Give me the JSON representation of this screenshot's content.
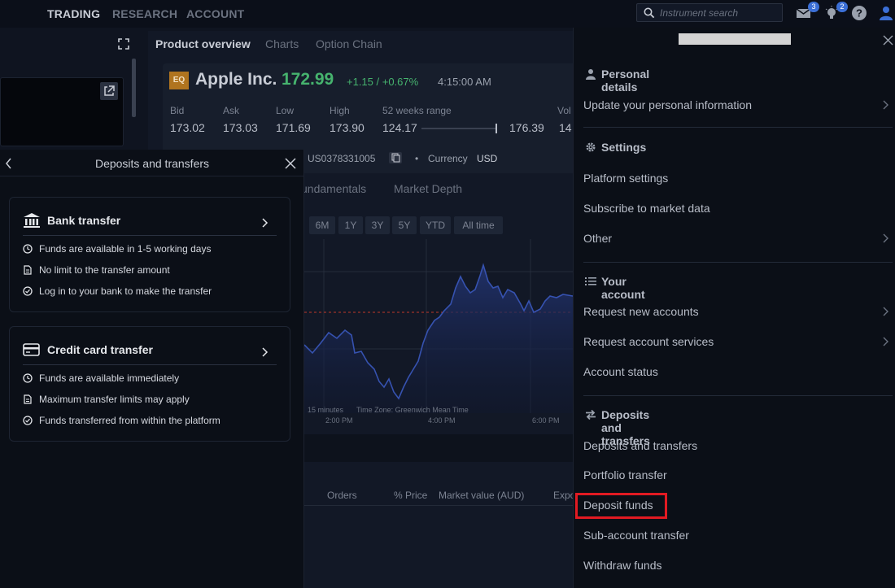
{
  "nav": {
    "items": [
      "TRADING",
      "RESEARCH",
      "ACCOUNT"
    ],
    "search_placeholder": "Instrument search",
    "mail_badge": "3",
    "ideas_badge": "2"
  },
  "product": {
    "tabs": [
      "Product overview",
      "Charts",
      "Option Chain"
    ],
    "badge": "EQ",
    "name": "Apple Inc.",
    "price": "172.99",
    "change": "+1.15 / +0.67%",
    "time": "4:15:00 AM",
    "quote_labels": [
      "Bid",
      "Ask",
      "Low",
      "High",
      "52 weeks range",
      "Vol"
    ],
    "quote_values": [
      "173.02",
      "173.03",
      "171.69",
      "173.90",
      "124.17",
      "176.39",
      "14"
    ],
    "isin": "US0378331005",
    "bullet": "•",
    "currency_label": "Currency",
    "currency": "USD",
    "subtabs": [
      "undamentals",
      "Market Depth"
    ],
    "periods": [
      "6M",
      "1Y",
      "3Y",
      "5Y",
      "YTD",
      "All time"
    ],
    "chart_foot": "15 minutes",
    "timezone": "Time Zone: Greenwich Mean Time",
    "time_ticks": [
      "2:00 PM",
      "4:00 PM",
      "6:00 PM"
    ],
    "table_headers": [
      "Orders",
      "% Price",
      "Market value (AUD)",
      "Expo"
    ]
  },
  "deposits": {
    "title": "Deposits and transfers",
    "bank": {
      "title": "Bank transfer",
      "features": [
        "Funds are available in 1-5 working days",
        "No limit to the transfer amount",
        "Log in to your bank to make the transfer"
      ]
    },
    "card": {
      "title": "Credit card transfer",
      "features": [
        "Funds are available immediately",
        "Maximum transfer limits may apply",
        "Funds transferred from within the platform"
      ]
    }
  },
  "menu": {
    "personal": {
      "title": "Personal details",
      "items": [
        "Update your personal information"
      ]
    },
    "settings": {
      "title": "Settings",
      "items": [
        "Platform settings",
        "Subscribe to market data",
        "Other"
      ]
    },
    "account": {
      "title": "Your account",
      "items": [
        "Request new accounts",
        "Request account services",
        "Account status"
      ]
    },
    "transfers": {
      "title": "Deposits and transfers",
      "items": [
        "Deposits and transfers",
        "Portfolio transfer",
        "Deposit funds",
        "Sub-account transfer",
        "Withdraw funds"
      ]
    }
  },
  "colors": {
    "accent_red": "#e21a22",
    "price_green": "#46b36e",
    "chart_line": "#2f4aa0"
  }
}
